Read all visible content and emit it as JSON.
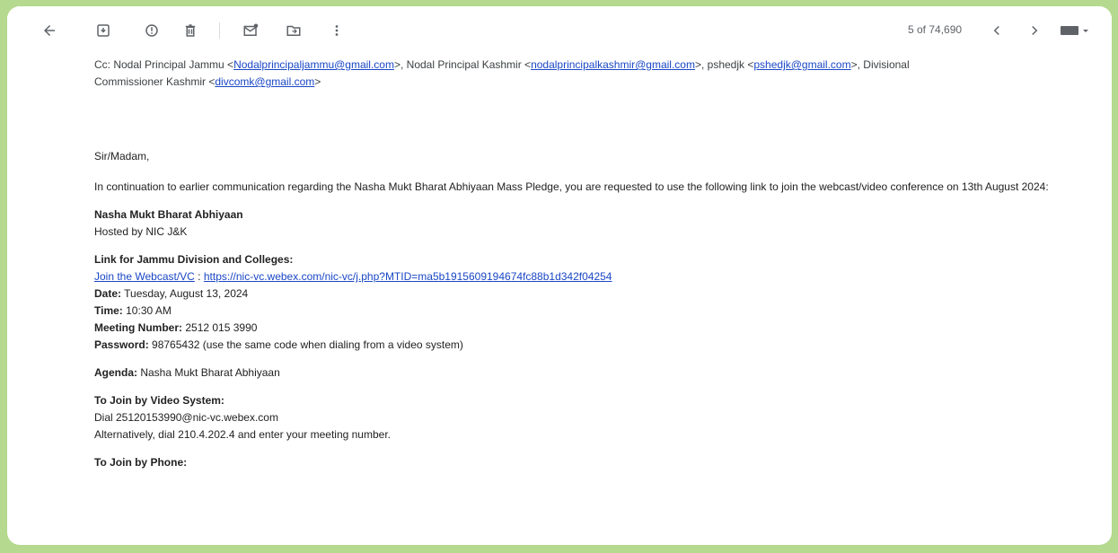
{
  "toolbar": {
    "pager_text": "5 of 74,690",
    "icons": [
      "back-arrow-icon",
      "archive-icon",
      "report-spam-icon",
      "delete-icon",
      "mark-unread-icon",
      "move-to-icon",
      "more-vert-icon",
      "chevron-left-icon",
      "chevron-right-icon",
      "keyboard-icon"
    ]
  },
  "email": {
    "cc_prefix": "Cc: Nodal Principal Jammu <",
    "cc_email_1": "Nodalprincipaljammu@gmail.com",
    "cc_mid_1": ">, Nodal Principal Kashmir <",
    "cc_email_2": "nodalprincipalkashmir@gmail.com",
    "cc_mid_2": ">, pshedjk <",
    "cc_email_3": "pshedjk@gmail.com",
    "cc_mid_3": ">, Divisional",
    "cc_line2_prefix": "Commissioner Kashmir <",
    "cc_email_4": "divcomk@gmail.com",
    "cc_line2_suffix": ">",
    "salutation": "Sir/Madam,",
    "intro": "In continuation to earlier communication regarding the Nasha Mukt Bharat Abhiyaan Mass Pledge, you are requested to use the following link to join the webcast/video conference on 13th August 2024:",
    "event_title": "Nasha Mukt Bharat Abhiyaan",
    "hosted_by": "Hosted by NIC J&K",
    "link_heading": "Link for Jammu Division and Colleges:",
    "join_link_label": "Join the Webcast/VC",
    "join_sep": " : ",
    "join_url": "https://nic-vc.webex.com/nic-vc/j.php?MTID=ma5b1915609194674fc88b1d342f04254",
    "date_label": "Date:",
    "date_value": " Tuesday, August 13, 2024",
    "time_label": "Time:",
    "time_value": " 10:30 AM",
    "meeting_label": "Meeting Number:",
    "meeting_value": " 2512 015 3990",
    "password_label": "Password:",
    "password_value": " 98765432 (use the same code when dialing from a video system)",
    "agenda_label": "Agenda:",
    "agenda_value": " Nasha Mukt Bharat Abhiyaan",
    "video_heading": "To Join by Video System:",
    "video_dial": "Dial 25120153990@nic-vc.webex.com",
    "video_alt": "Alternatively, dial 210.4.202.4 and enter your meeting number.",
    "phone_heading": "To Join by Phone:"
  }
}
